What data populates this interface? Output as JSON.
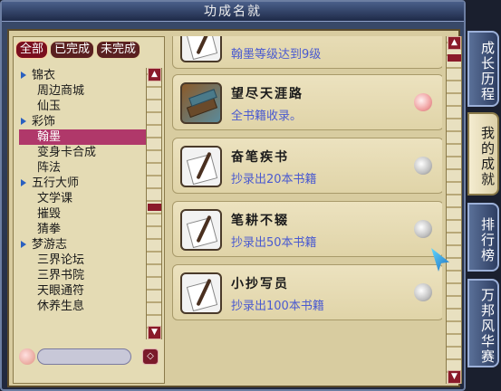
{
  "window": {
    "title": "功成名就"
  },
  "filters": [
    {
      "label": "全部",
      "active": true
    },
    {
      "label": "已完成",
      "active": false
    },
    {
      "label": "未完成",
      "active": false
    }
  ],
  "tree": [
    {
      "label": "锦衣",
      "type": "parent"
    },
    {
      "label": "周边商城",
      "type": "child"
    },
    {
      "label": "仙玉",
      "type": "child"
    },
    {
      "label": "彩饰",
      "type": "parent"
    },
    {
      "label": "翰墨",
      "type": "child",
      "selected": true
    },
    {
      "label": "变身卡合成",
      "type": "child"
    },
    {
      "label": "阵法",
      "type": "child"
    },
    {
      "label": "五行大师",
      "type": "parent"
    },
    {
      "label": "文学课",
      "type": "child"
    },
    {
      "label": "摧毁",
      "type": "child"
    },
    {
      "label": "猜拳",
      "type": "child"
    },
    {
      "label": "梦游志",
      "type": "parent"
    },
    {
      "label": "三界论坛",
      "type": "child"
    },
    {
      "label": "三界书院",
      "type": "child"
    },
    {
      "label": "天眼通符",
      "type": "child"
    },
    {
      "label": "休养生息",
      "type": "child"
    }
  ],
  "achievements": [
    {
      "title": "",
      "desc": "翰墨等级达到9级",
      "icon": "brush-paper-icon",
      "badge": "none"
    },
    {
      "title": "望尽天涯路",
      "desc": "全书籍收录。",
      "icon": "books-icon",
      "badge": "peach"
    },
    {
      "title": "奋笔疾书",
      "desc": "抄录出20本书籍",
      "icon": "brush-paper-icon",
      "badge": "silver"
    },
    {
      "title": "笔耕不辍",
      "desc": "抄录出50本书籍",
      "icon": "brush-paper-icon",
      "badge": "silver"
    },
    {
      "title": "小抄写员",
      "desc": "抄录出100本书籍",
      "icon": "brush-paper-icon",
      "badge": "silver"
    }
  ],
  "tabs": [
    {
      "label": "成长历程",
      "active": false
    },
    {
      "label": "我的成就",
      "active": true
    },
    {
      "label": "排行榜",
      "active": false
    },
    {
      "label": "万邦风华赛",
      "active": false
    }
  ],
  "colors": {
    "accent": "#7a0f1e",
    "desc_text": "#4a5ad0",
    "selected_row": "#b0386a"
  }
}
